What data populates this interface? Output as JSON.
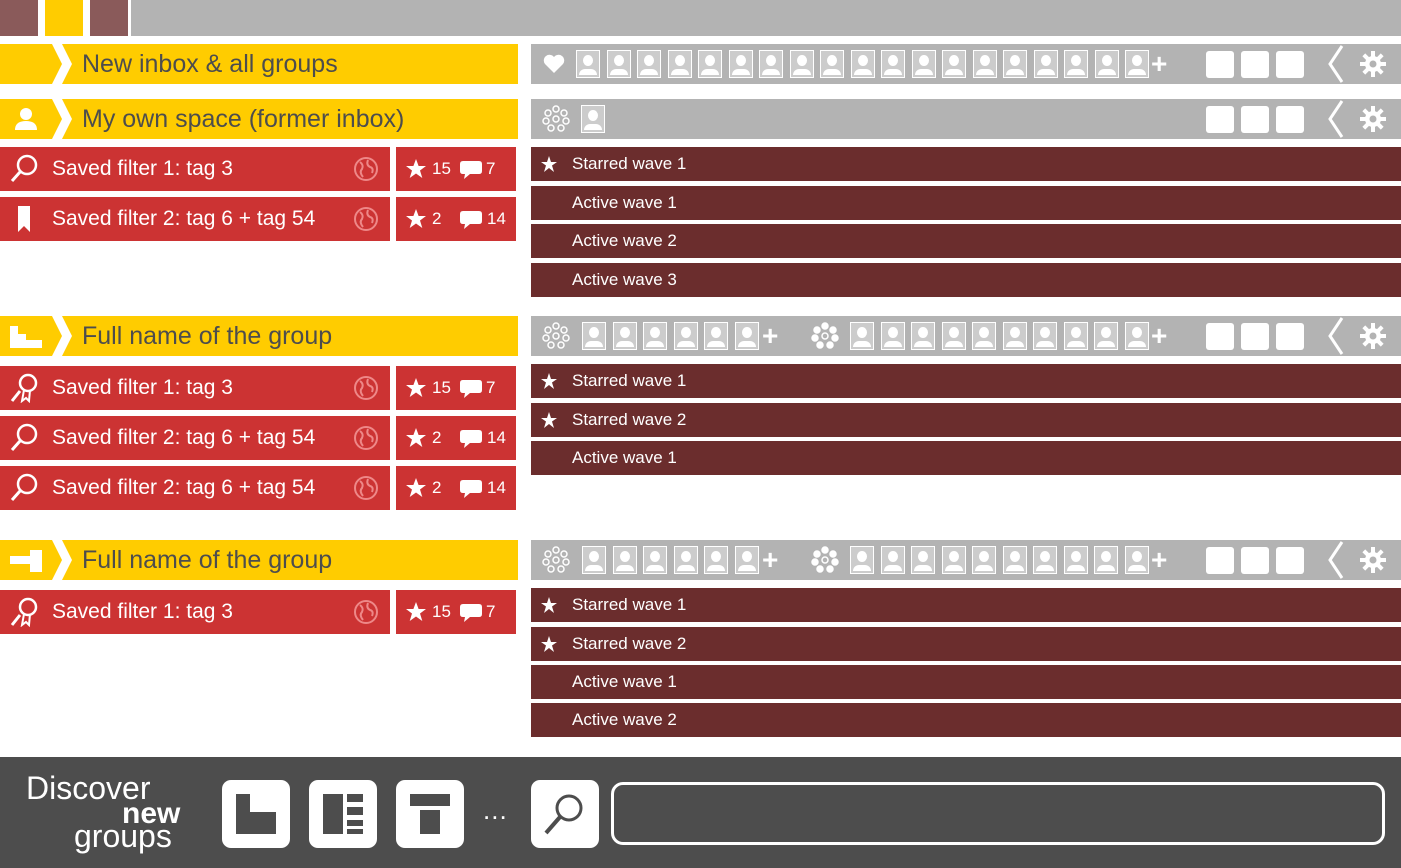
{
  "colors": {
    "yellow": "#ffcc00",
    "grey": "#b3b3b3",
    "red": "#cc3333",
    "wave": "#6b2d2d",
    "dark": "#4d4d4d",
    "tab_brown": "#8a5a5a"
  },
  "header": {
    "all_groups_title": "New inbox & all groups",
    "own_space_title": "My own space (former inbox)"
  },
  "groups": [
    {
      "title": "Full name of the group"
    },
    {
      "title": "Full name of the group"
    }
  ],
  "own_space": {
    "filters": [
      {
        "label": "Saved filter 1: tag 3",
        "icon": "magnifier-icon",
        "stars": "15",
        "comments": "7"
      },
      {
        "label": "Saved filter 2: tag 6 + tag 54",
        "icon": "bookmark-icon",
        "stars": "2",
        "comments": "14"
      }
    ],
    "waves": [
      {
        "label": "Starred wave 1",
        "starred": true
      },
      {
        "label": "Active wave 1",
        "starred": false
      },
      {
        "label": "Active wave 2",
        "starred": false
      },
      {
        "label": "Active wave 3",
        "starred": false
      }
    ]
  },
  "group1": {
    "filters": [
      {
        "label": "Saved filter 1: tag 3",
        "icon": "ribbon-magnifier-icon",
        "stars": "15",
        "comments": "7"
      },
      {
        "label": "Saved filter 2: tag 6 + tag 54",
        "icon": "magnifier-icon",
        "stars": "2",
        "comments": "14"
      },
      {
        "label": "Saved filter 2: tag 6 + tag 54",
        "icon": "magnifier-icon",
        "stars": "2",
        "comments": "14"
      }
    ],
    "waves": [
      {
        "label": "Starred wave 1",
        "starred": true
      },
      {
        "label": "Starred wave 2",
        "starred": true
      },
      {
        "label": "Active wave 1",
        "starred": false
      }
    ]
  },
  "group2": {
    "filters": [
      {
        "label": "Saved filter 1: tag 3",
        "icon": "ribbon-magnifier-icon",
        "stars": "15",
        "comments": "7"
      }
    ],
    "waves": [
      {
        "label": "Starred wave 1",
        "starred": true
      },
      {
        "label": "Starred wave 2",
        "starred": true
      },
      {
        "label": "Active wave 1",
        "starred": false
      },
      {
        "label": "Active wave 2",
        "starred": false
      }
    ]
  },
  "toolbar": {
    "plus": "+"
  },
  "bottom": {
    "discover_line1": "Discover",
    "discover_line2": "new",
    "discover_line3": "groups",
    "more": "...",
    "search_value": ""
  }
}
